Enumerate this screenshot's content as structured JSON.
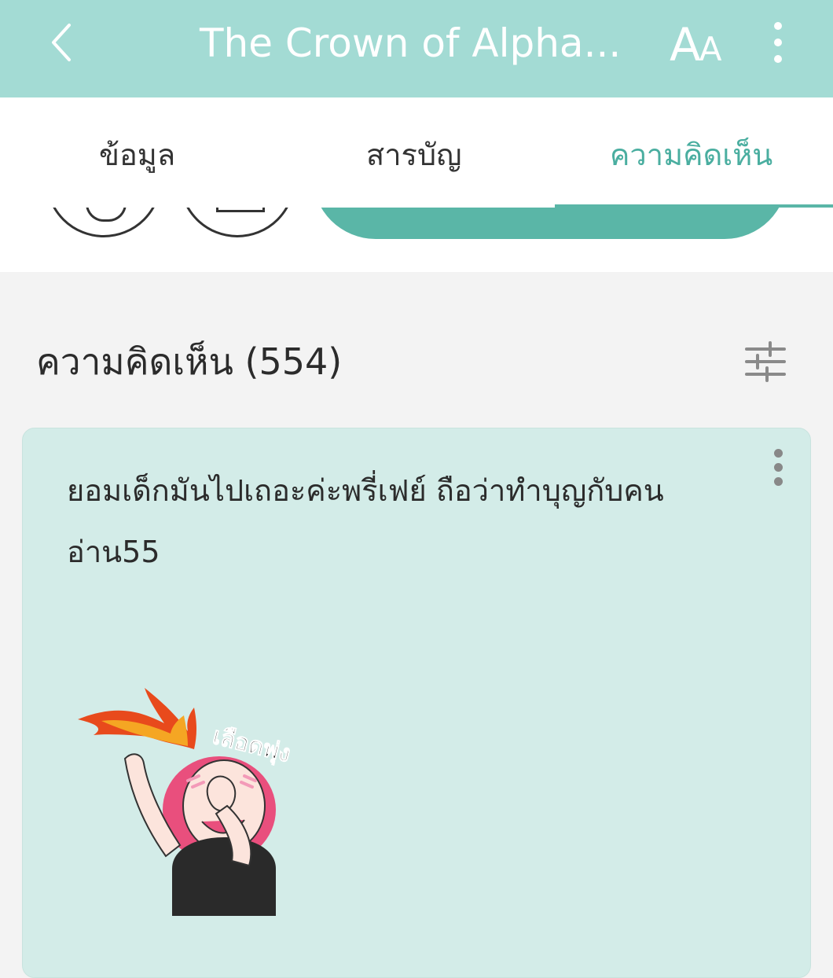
{
  "header": {
    "title": "The Crown of Alpha...",
    "font_button_big": "A",
    "font_button_small": "A"
  },
  "tabs": [
    {
      "label": "ข้อมูล",
      "active": false
    },
    {
      "label": "สารบัญ",
      "active": false
    },
    {
      "label": "ความคิดเห็น",
      "active": true
    }
  ],
  "comments_section": {
    "title": "ความคิดเห็น (554)"
  },
  "comment": {
    "text": "ยอมเด็กมันไปเถอะค่ะพรี่เฟย์ ถือว่าทำบุญกับคนอ่าน55",
    "sticker_text": "เลือดพุ่ง"
  },
  "colors": {
    "header_bg": "#a3dbd4",
    "accent": "#5ab6a7",
    "active_tab_text": "#4aaea0",
    "card_bg": "#d3ece8",
    "page_bg": "#f3f3f3"
  },
  "icons": [
    "back-chevron-icon",
    "font-size-icon",
    "more-vertical-icon",
    "filter-sliders-icon",
    "comment-more-icon"
  ]
}
